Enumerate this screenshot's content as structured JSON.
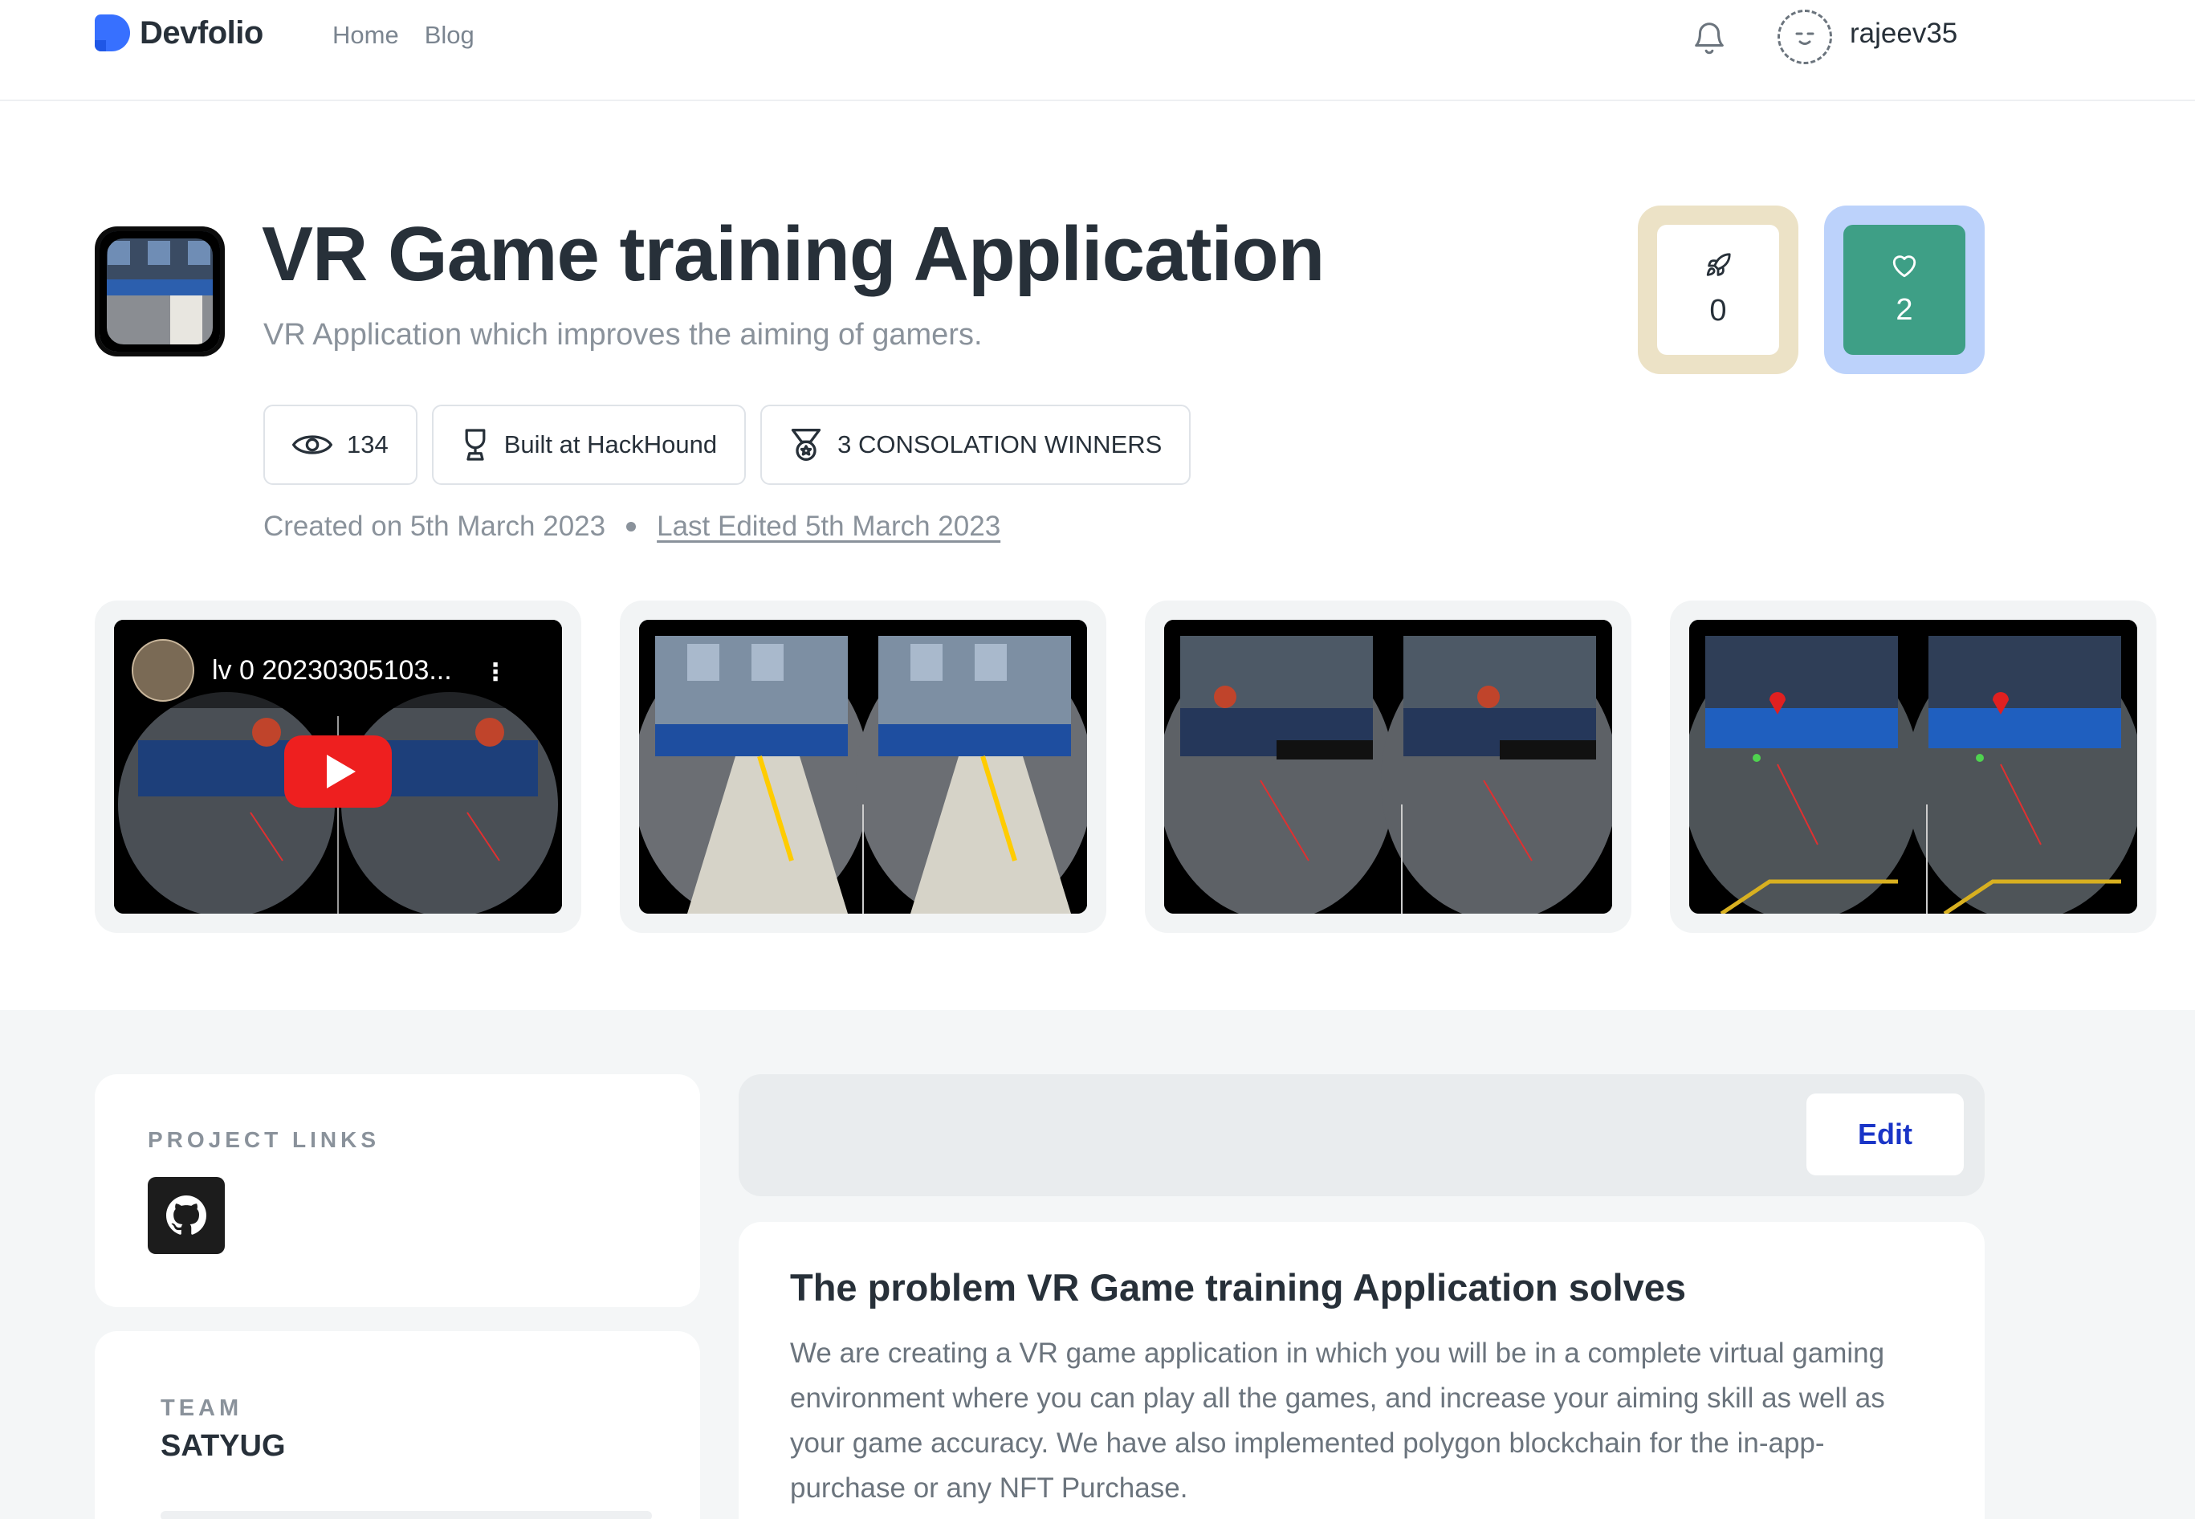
{
  "colors": {
    "brand": "#3770ff",
    "like_frame": "#ece2c6",
    "heart_frame": "#bcd2fb",
    "heart_fill": "#3e9f86",
    "edit_text": "#1a35c7"
  },
  "nav": {
    "brand": "Devfolio",
    "links": [
      "Home",
      "Blog"
    ],
    "username": "rajeev35",
    "icons": [
      "bell-icon",
      "avatar-icon"
    ]
  },
  "project": {
    "title": "VR Game training Application",
    "tagline": "VR Application which improves the aiming of gamers.",
    "views": "134",
    "built_at": "Built at HackHound",
    "award": "3 CONSOLATION WINNERS",
    "created": "Created on 5th March 2023",
    "edited": "Last Edited 5th March 2023",
    "likes": "0",
    "hearts": "2"
  },
  "gallery": {
    "video_title": "lv 0 20230305103...",
    "items": [
      "video-thumbnail",
      "screenshot-1",
      "screenshot-2",
      "screenshot-3"
    ]
  },
  "links_card": {
    "label": "PROJECT LINKS",
    "icons": [
      "github-icon"
    ]
  },
  "team_card": {
    "label": "TEAM",
    "name": "SATYUG"
  },
  "toolbar": {
    "edit_label": "Edit"
  },
  "content": {
    "heading": "The problem VR Game training Application solves",
    "body": "We are creating a VR game application in which you will be in a complete virtual gaming environment where you can play all the games, and increase your aiming skill as well as your game accuracy. We have also implemented polygon blockchain for the in-app-purchase or any NFT Purchase."
  }
}
